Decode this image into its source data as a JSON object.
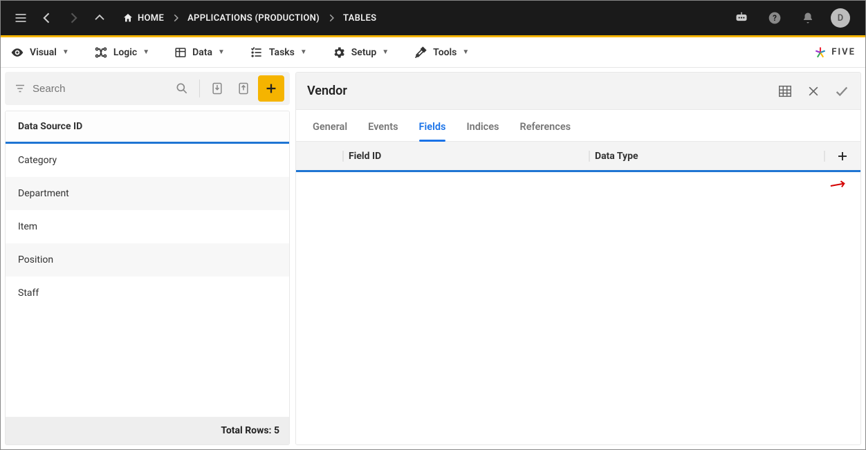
{
  "topbar": {
    "home_label": "HOME",
    "bc1": "APPLICATIONS (PRODUCTION)",
    "bc2": "TABLES",
    "avatar_letter": "D"
  },
  "menubar": {
    "items": [
      {
        "label": "Visual"
      },
      {
        "label": "Logic"
      },
      {
        "label": "Data"
      },
      {
        "label": "Tasks"
      },
      {
        "label": "Setup"
      },
      {
        "label": "Tools"
      }
    ],
    "brand": "FIVE"
  },
  "sidepanel": {
    "search_placeholder": "Search",
    "list_header": "Data Source ID",
    "rows": [
      {
        "label": "Category"
      },
      {
        "label": "Department"
      },
      {
        "label": "Item"
      },
      {
        "label": "Position"
      },
      {
        "label": "Staff"
      }
    ],
    "footer": "Total Rows: 5"
  },
  "detail": {
    "title": "Vendor",
    "tabs": [
      {
        "label": "General"
      },
      {
        "label": "Events"
      },
      {
        "label": "Fields"
      },
      {
        "label": "Indices"
      },
      {
        "label": "References"
      }
    ],
    "active_tab": 2,
    "columns": {
      "field_id": "Field ID",
      "data_type": "Data Type"
    }
  }
}
